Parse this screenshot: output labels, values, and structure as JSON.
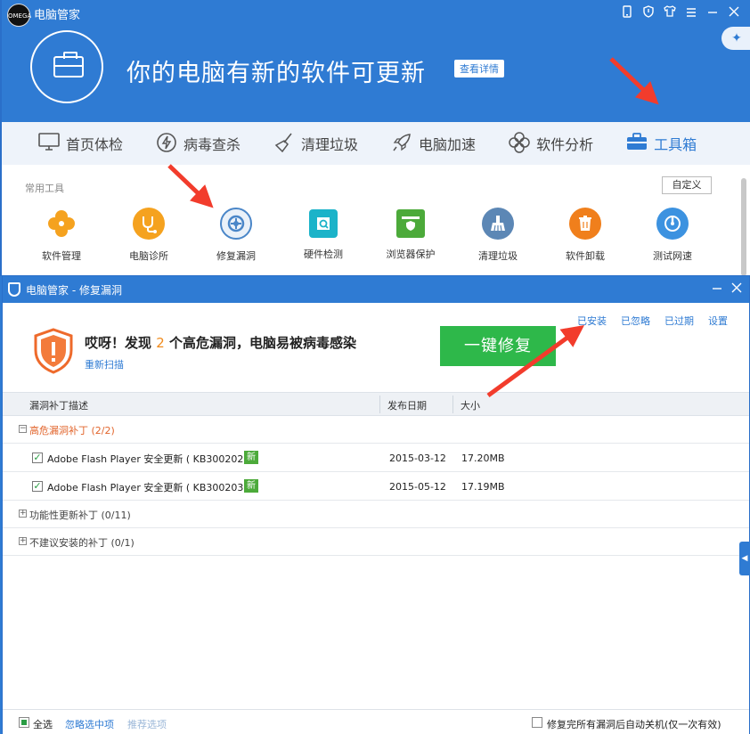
{
  "app": {
    "logo_text": "OMEGA",
    "title": "电脑管家",
    "titlebar_icons": [
      "phone-icon",
      "shield-icon",
      "shirt-icon",
      "menu-icon",
      "minimize-icon",
      "close-icon"
    ],
    "hero_text": "你的电脑有新的软件可更新",
    "detail_button": "查看详情"
  },
  "nav": [
    {
      "label": "首页体检",
      "icon": "monitor-icon",
      "active": false
    },
    {
      "label": "病毒查杀",
      "icon": "lightning-icon",
      "active": false
    },
    {
      "label": "清理垃圾",
      "icon": "broom-icon",
      "active": false
    },
    {
      "label": "电脑加速",
      "icon": "rocket-icon",
      "active": false
    },
    {
      "label": "软件分析",
      "icon": "flower-icon",
      "active": false
    },
    {
      "label": "工具箱",
      "icon": "toolbox-icon",
      "active": true
    }
  ],
  "tools": {
    "section_label": "常用工具",
    "custom_button": "自定义",
    "items": [
      {
        "label": "软件管理",
        "icon": "clover-icon",
        "color": "#f5a21f"
      },
      {
        "label": "电脑诊所",
        "icon": "stethoscope-icon",
        "color": "#f5a21f"
      },
      {
        "label": "修复漏洞",
        "icon": "repair-icon",
        "color": "#4a86c8"
      },
      {
        "label": "硬件检测",
        "icon": "chip-icon",
        "color": "#1bb3c9"
      },
      {
        "label": "浏览器保护",
        "icon": "browser-shield-icon",
        "color": "#4caa3a"
      },
      {
        "label": "清理垃圾",
        "icon": "broom-icon",
        "color": "#5c87b5"
      },
      {
        "label": "软件卸载",
        "icon": "trash-icon",
        "color": "#f07f1c"
      },
      {
        "label": "测试网速",
        "icon": "speed-icon",
        "color": "#3c92e0"
      }
    ]
  },
  "dialog": {
    "title": "电脑管家 - 修复漏洞",
    "alert_prefix": "哎呀！发现",
    "alert_count": "2",
    "alert_suffix": "个高危漏洞，电脑易被病毒感染",
    "rescan_link": "重新扫描",
    "fix_button": "一键修复",
    "top_links": [
      "已安装",
      "已忽略",
      "已过期",
      "设置"
    ],
    "columns": [
      "漏洞补丁描述",
      "发布日期",
      "大小"
    ],
    "groups": [
      {
        "label": "高危漏洞补丁 (2/2)",
        "expanded": true,
        "severity": "high"
      },
      {
        "label": "功能性更新补丁 (0/11)",
        "expanded": false,
        "severity": "normal"
      },
      {
        "label": "不建议安装的补丁 (0/1)",
        "expanded": false,
        "severity": "normal"
      }
    ],
    "patches": [
      {
        "name": "Adobe Flash Player 安全更新 ( KB300202 )",
        "badge": "新",
        "date": "2015-03-12",
        "size": "17.20MB",
        "checked": true
      },
      {
        "name": "Adobe Flash Player 安全更新 ( KB300203 )",
        "badge": "新",
        "date": "2015-05-12",
        "size": "17.19MB",
        "checked": true
      }
    ],
    "footer": {
      "select_all": "全选",
      "ignore_selected": "忽略选中项",
      "recommended": "推荐选项",
      "auto_shutdown": "修复完所有漏洞后自动关机(仅一次有效)"
    }
  },
  "colors": {
    "brand_blue": "#2f7bd3",
    "fix_green": "#2eb84a",
    "warn_orange": "#e2652c",
    "arrow_red": "#f23c2c"
  }
}
